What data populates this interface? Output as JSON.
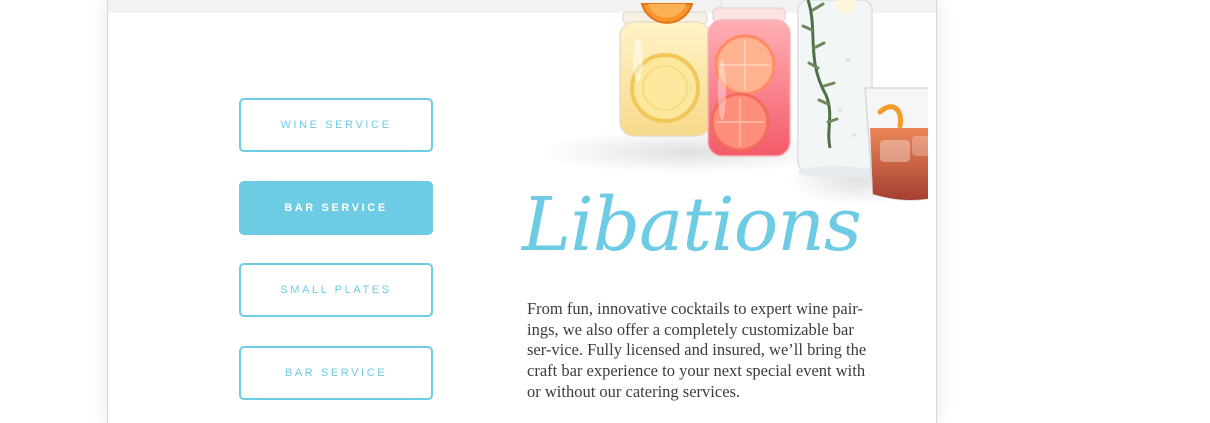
{
  "services": {
    "buttons": [
      {
        "label": "WINE SERVICE"
      },
      {
        "label": "BAR SERVICE"
      },
      {
        "label": "SMALL PLATES"
      },
      {
        "label": "BAR SERVICE"
      }
    ],
    "active_index": 1
  },
  "content": {
    "title": "Libations",
    "body": "From fun, innovative cocktails to expert wine pair-ings, we also offer a completely customizable bar ser-vice. Fully licensed and insured, we’ll bring the craft bar experience to your next special event with or without our catering services."
  },
  "colors": {
    "accent": "#6ecbe4",
    "text": "#3c3c3c",
    "topbar": "#f2f2f2"
  },
  "image": {
    "icon": "cocktail-drinks-photo"
  }
}
